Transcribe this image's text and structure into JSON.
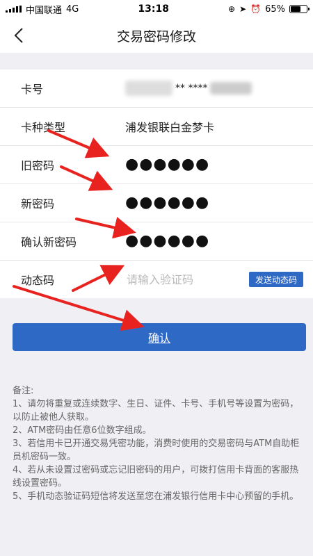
{
  "status_bar": {
    "carrier": "中国联通",
    "network": "4G",
    "time": "13:18",
    "battery": "65%"
  },
  "nav": {
    "title": "交易密码修改"
  },
  "form": {
    "card_no_label": "卡号",
    "card_no_value": "** ****",
    "card_type_label": "卡种类型",
    "card_type_value": "浦发银联白金梦卡",
    "old_pwd_label": "旧密码",
    "old_pwd_value": "●●●●●●",
    "new_pwd_label": "新密码",
    "new_pwd_value": "●●●●●●",
    "confirm_pwd_label": "确认新密码",
    "confirm_pwd_value": "●●●●●●",
    "code_label": "动态码",
    "code_placeholder": "请输入验证码",
    "send_code_label": "发送动态码"
  },
  "confirm_label": "确认",
  "notes": {
    "title": "备注:",
    "lines": [
      "1、请勿将重复或连续数字、生日、证件、卡号、手机号等设置为密码，以防止被他人获取。",
      "2、ATM密码由任意6位数字组成。",
      "3、若信用卡已开通交易凭密功能，消费时使用的交易密码与ATM自助柜员机密码一致。",
      "4、若从未设置过密码或忘记旧密码的用户，可拨打信用卡背面的客服热线设置密码。",
      "5、手机动态验证码短信将发送至您在浦发银行信用卡中心预留的手机。"
    ]
  },
  "colors": {
    "primary": "#2f69c6",
    "annotation_arrow": "#e8231f"
  }
}
